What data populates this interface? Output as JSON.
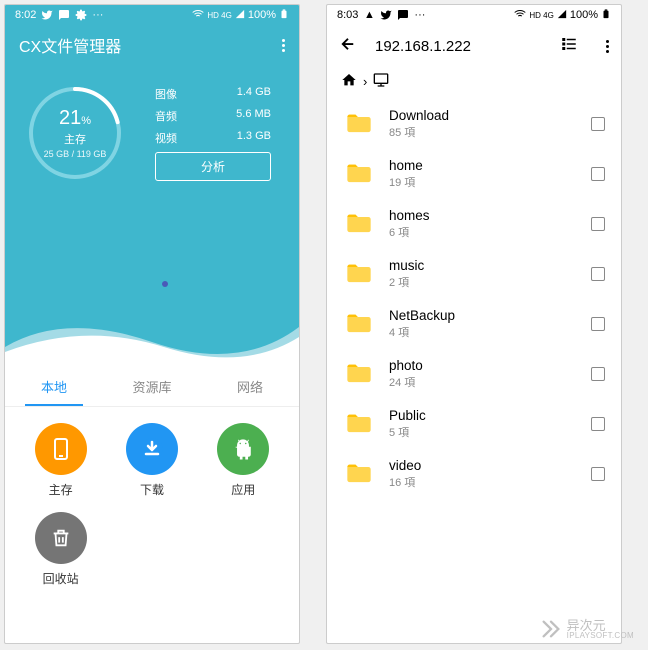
{
  "statusbar_left": {
    "time": "8:02"
  },
  "statusbar_right": {
    "time": "8:03"
  },
  "status_right": {
    "net": "HD 4G",
    "battery": "100%"
  },
  "left": {
    "app_title": "CX文件管理器",
    "ring": {
      "pct": "21",
      "pct_unit": "%",
      "label": "主存",
      "sub": "25 GB / 119 GB"
    },
    "stats": [
      {
        "label": "图像",
        "value": "1.4 GB"
      },
      {
        "label": "音频",
        "value": "5.6 MB"
      },
      {
        "label": "视频",
        "value": "1.3 GB"
      }
    ],
    "analyze": "分析",
    "tabs": [
      "本地",
      "资源库",
      "网络"
    ],
    "grid": [
      {
        "name": "主存",
        "icon": "phone",
        "color": "ic-orange"
      },
      {
        "name": "下载",
        "icon": "download",
        "color": "ic-blue"
      },
      {
        "name": "应用",
        "icon": "android",
        "color": "ic-green"
      },
      {
        "name": "回收站",
        "icon": "trash",
        "color": "ic-grey"
      }
    ]
  },
  "right": {
    "title": "192.168.1.222",
    "folders": [
      {
        "name": "Download",
        "count": "85 項"
      },
      {
        "name": "home",
        "count": "19 項"
      },
      {
        "name": "homes",
        "count": "6 項"
      },
      {
        "name": "music",
        "count": "2 項"
      },
      {
        "name": "NetBackup",
        "count": "4 項"
      },
      {
        "name": "photo",
        "count": "24 項"
      },
      {
        "name": "Public",
        "count": "5 項"
      },
      {
        "name": "video",
        "count": "16 項"
      }
    ]
  },
  "watermark": {
    "cn": "异次元",
    "url": "IPLAYSOFT.COM"
  }
}
